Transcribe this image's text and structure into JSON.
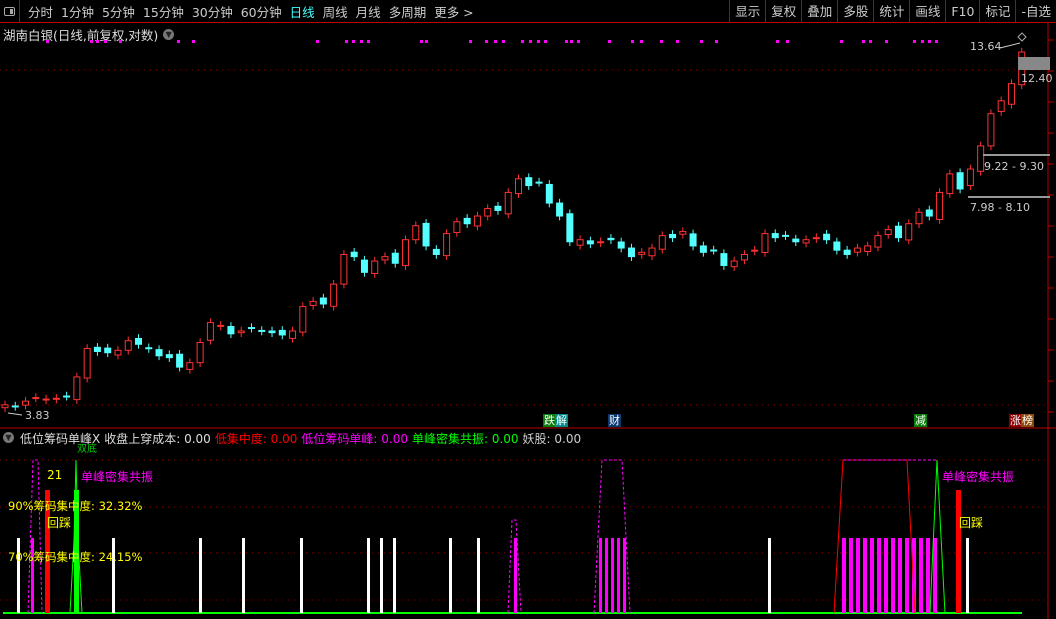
{
  "toolbar": {
    "periods": [
      "分时",
      "1分钟",
      "5分钟",
      "15分钟",
      "30分钟",
      "60分钟",
      "日线",
      "周线",
      "月线",
      "多周期",
      "更多 >"
    ],
    "active_period": "日线",
    "right_tools": [
      "显示",
      "复权",
      "叠加",
      "多股",
      "统计",
      "画线",
      "F10",
      "标记",
      "-自选"
    ]
  },
  "chart_title": "湖南白银(日线,前复权,对数)",
  "price_labels": {
    "high": "13.64",
    "last": "12.40",
    "low": "3.83",
    "zone1": "9.22 - 9.30",
    "zone2": "7.98 - 8.10"
  },
  "event_tags": [
    {
      "text": "跌",
      "color": "#0a7a0a"
    },
    {
      "text": "解",
      "color": "#088"
    },
    {
      "text": "财",
      "color": "#0a3a70"
    },
    {
      "text": "减",
      "color": "#0a7a0a"
    },
    {
      "text": "涨",
      "color": "#8a0000"
    },
    {
      "text": "榜",
      "color": "#8a4a0a"
    }
  ],
  "indicator": {
    "name": "低位筹码单峰X",
    "items": [
      {
        "label": "收盘上穿成本: 0.00",
        "color": "#ddd"
      },
      {
        "label": "低集中度: 0.00",
        "color": "#f00"
      },
      {
        "label": "低位筹码单峰: 0.00",
        "color": "#f0f"
      },
      {
        "label": "单峰密集共振: 0.00",
        "color": "#0f0"
      },
      {
        "label": "妖股: 0.00",
        "color": "#ccc"
      }
    ],
    "annotations": {
      "count": "21",
      "resonance1": "单峰密集共振",
      "resonance2": "单峰密集共振",
      "pullback1": "回踩",
      "pullback2": "回踩",
      "cut_label": "双底",
      "conc90": "90%筹码集中度: 32.32%",
      "conc70": "70%筹码集中度: 24.15%"
    }
  },
  "colors": {
    "up": "#ff3232",
    "down": "#54ffff",
    "magenta": "#ff00ff",
    "axis": "#b00000"
  },
  "candles_close": [
    3.9,
    3.88,
    3.95,
    4.0,
    3.98,
    3.99,
    4.02,
    4.3,
    4.75,
    4.7,
    4.68,
    4.72,
    4.88,
    4.82,
    4.75,
    4.63,
    4.6,
    4.45,
    4.52,
    4.85,
    5.2,
    5.15,
    5.0,
    5.05,
    5.1,
    5.05,
    5.02,
    4.98,
    5.05,
    5.5,
    5.6,
    5.55,
    5.95,
    6.6,
    6.55,
    6.2,
    6.45,
    6.55,
    6.4,
    6.95,
    7.3,
    6.8,
    6.6,
    7.1,
    7.4,
    7.35,
    7.55,
    7.75,
    7.7,
    8.2,
    8.6,
    8.4,
    8.5,
    7.9,
    7.55,
    6.9,
    6.95,
    6.85,
    6.9,
    6.95,
    6.75,
    6.55,
    6.65,
    6.75,
    7.05,
    7.0,
    7.15,
    6.8,
    6.65,
    6.7,
    6.35,
    6.45,
    6.6,
    6.7,
    7.1,
    7.0,
    7.05,
    6.9,
    6.95,
    7.0,
    6.95,
    6.7,
    6.6,
    6.75,
    6.8,
    7.05,
    7.2,
    7.0,
    7.35,
    7.65,
    7.55,
    8.2,
    8.75,
    8.3,
    8.9,
    9.65,
    10.8,
    11.3,
    12.0,
    13.4
  ]
}
